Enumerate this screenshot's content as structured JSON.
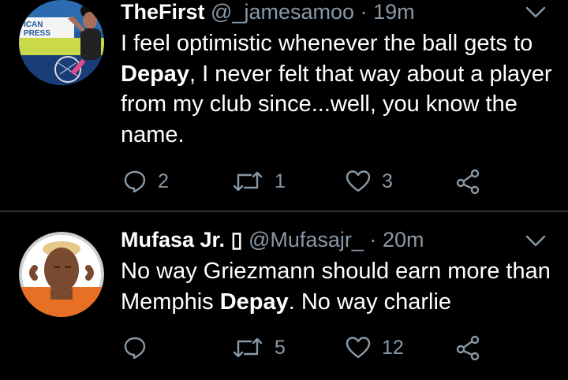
{
  "tweets": [
    {
      "name": "TheFirst",
      "handle": "@_jamesamoo",
      "sep": "·",
      "time": "19m",
      "text_parts": [
        "I feel optimistic whenever the ball gets to ",
        "Depay",
        ", I never felt that way about a player from my club since...well, you know the name."
      ],
      "replies": "2",
      "retweets": "1",
      "likes": "3",
      "avatar_text": "ICAN PRESS"
    },
    {
      "name": "Mufasa Jr. ",
      "name_glyph": "▯",
      "handle": "@Mufasajr_",
      "sep": "·",
      "time": "20m",
      "text_parts": [
        "No way Griezmann should earn more than Memphis ",
        "Depay",
        ". No way charlie"
      ],
      "replies": "",
      "retweets": "5",
      "likes": "12"
    }
  ],
  "colors": {
    "background": "#000000",
    "text": "#ffffff",
    "muted": "#8899a6",
    "divider": "#2f3336"
  },
  "icons": [
    "reply-icon",
    "retweet-icon",
    "like-icon",
    "share-icon",
    "chevron-down-icon"
  ]
}
